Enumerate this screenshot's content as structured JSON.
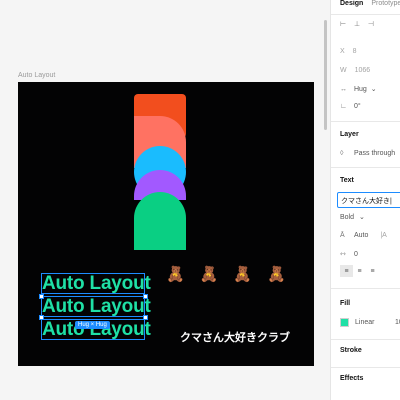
{
  "canvas": {
    "frame_label": "Auto Layout",
    "auto_lines": [
      "Auto Layout",
      "Auto Layout",
      "Auto Layout"
    ],
    "hug_badge": "Hug × Hug",
    "bears": [
      "🧸",
      "🧸",
      "🧸",
      "🧸"
    ],
    "jp_text": "クマさん大好きクラブ"
  },
  "panel": {
    "tabs": [
      "Design",
      "Prototype"
    ],
    "x_label": "X",
    "x_value": "8",
    "w_label": "W",
    "w_value": "1066",
    "hug_label": "Hug",
    "rotation": "0°",
    "layer_title": "Layer",
    "blend_mode": "Pass through",
    "text_title": "Text",
    "text_value": "クマさん大好き|",
    "font_weight": "Bold",
    "line_height": "Auto",
    "letter_spacing": "0",
    "fill_title": "Fill",
    "fill_type": "Linear",
    "fill_value": "10",
    "stroke_title": "Stroke",
    "effects_title": "Effects"
  },
  "colors": {
    "accent": "#1d8cff",
    "auto_text": "#1fe0a6",
    "frame_bg": "#030304",
    "logo_orange": "#f24e1e",
    "logo_coral": "#ff7262",
    "logo_blue": "#1abcfe",
    "logo_purple": "#a259ff",
    "logo_green": "#0acf83"
  }
}
